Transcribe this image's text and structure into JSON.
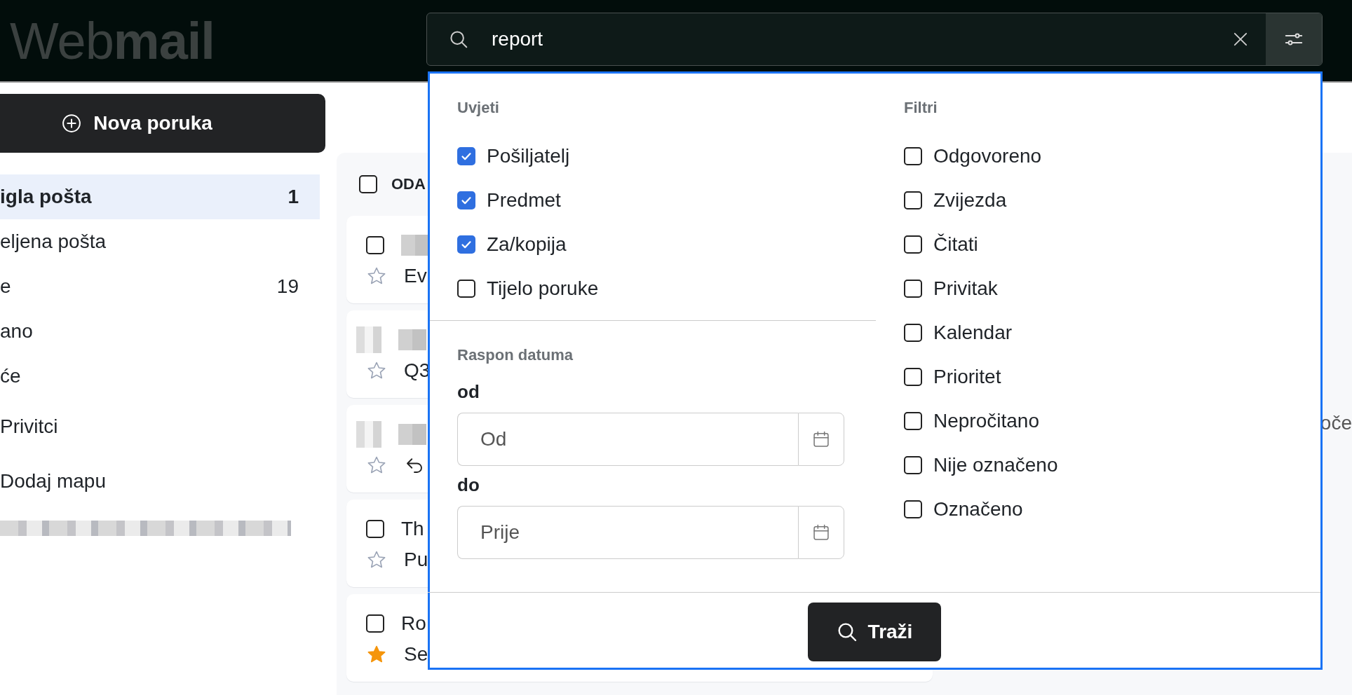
{
  "header": {
    "logo": "Web**mail**"
  },
  "search": {
    "value": "report"
  },
  "sidebar": {
    "compose_button": "Nova poruka",
    "folders": [
      {
        "label": "igla pošta",
        "count": "1",
        "selected": true
      },
      {
        "label": "eljena pošta",
        "selected": false
      },
      {
        "label": "e",
        "count": "19",
        "selected": false
      },
      {
        "label": "ano",
        "selected": false
      },
      {
        "label": "će",
        "selected": false
      }
    ],
    "links": [
      "Privitci",
      "Dodaj mapu"
    ],
    "footer": {
      "kind": "blurred"
    }
  },
  "email_list": {
    "select_all_checked": false,
    "header_label": "ODA",
    "messages": [
      {
        "kind": "checkbox",
        "checked": false,
        "line2": "Ev",
        "starred": false,
        "replied": false
      },
      {
        "kind": "avatar",
        "line2": "Q3",
        "starred": false,
        "replied": false
      },
      {
        "kind": "avatar",
        "starred": false,
        "replied": true
      },
      {
        "kind": "checkbox",
        "checked": false,
        "line1": "Th",
        "line2": "Pu",
        "starred": false,
        "replied": false
      },
      {
        "kind": "checkbox",
        "checked": false,
        "line1": "Ro",
        "line2": "Se",
        "starred": true,
        "replied": false
      }
    ]
  },
  "reading_pane": {
    "text": "oče"
  },
  "search_panel": {
    "conditions_title": "Uvjeti",
    "conditions": [
      {
        "label": "Pošiljatelj",
        "checked": true
      },
      {
        "label": "Predmet",
        "checked": true
      },
      {
        "label": "Za/kopija",
        "checked": true
      },
      {
        "label": "Tijelo poruke",
        "checked": false
      }
    ],
    "date_range": {
      "title": "Raspon datuma",
      "from": {
        "label": "od",
        "placeholder": "Od"
      },
      "to": {
        "label": "do",
        "placeholder": "Prije"
      }
    },
    "filters_title": "Filtri",
    "filters": [
      {
        "label": "Odgovoreno",
        "checked": false
      },
      {
        "label": "Zvijezda",
        "checked": false
      },
      {
        "label": "Čitati",
        "checked": false
      },
      {
        "label": "Privitak",
        "checked": false
      },
      {
        "label": "Kalendar",
        "checked": false
      },
      {
        "label": "Prioritet",
        "checked": false
      },
      {
        "label": "Nepročitano",
        "checked": false
      },
      {
        "label": "Nije označeno",
        "checked": false
      },
      {
        "label": "Označeno",
        "checked": false
      }
    ],
    "submit": "Traži"
  }
}
